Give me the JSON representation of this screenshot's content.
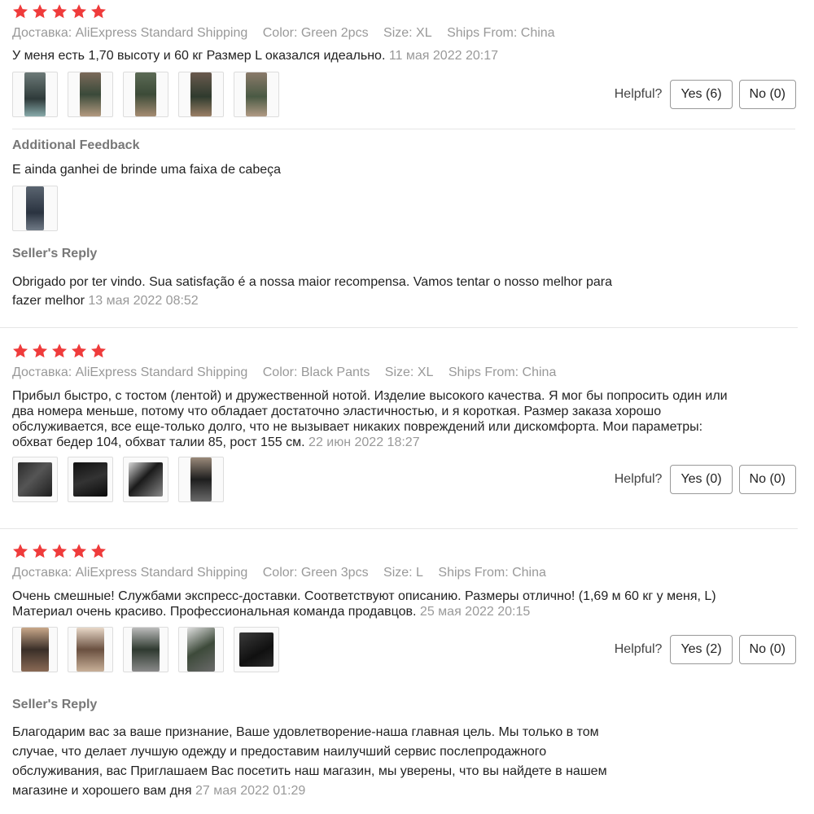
{
  "colors": {
    "star": "#ef3b3b",
    "muted": "#999999"
  },
  "reviews": [
    {
      "stars": 5,
      "shipping": "Доставка: AliExpress Standard Shipping",
      "color": "Color: Green 2pcs",
      "size": "Size: XL",
      "ships_from": "Ships From: China",
      "text": "У меня есть 1,70 высоту и 60 кг Размер L оказался идеально.",
      "date": "11 мая 2022 20:17",
      "helpful_label": "Helpful?",
      "yes_label": "Yes (6)",
      "no_label": "No (0)",
      "additional_feedback_title": "Additional Feedback",
      "additional_feedback_text": "E ainda ganhei de brinde uma faixa de cabeça",
      "seller_reply_title": "Seller's Reply",
      "seller_reply_line1": "Obrigado por ter vindo. Sua satisfação é a nossa maior recompensa. Vamos tentar o nosso melhor para",
      "seller_reply_line2": "fazer melhor",
      "seller_reply_date": "13 мая 2022 08:52"
    },
    {
      "stars": 5,
      "shipping": "Доставка: AliExpress Standard Shipping",
      "color": "Color: Black Pants",
      "size": "Size: XL",
      "ships_from": "Ships From: China",
      "text_line1": "Прибыл быстро, с тостом (лентой) и дружественной нотой. Изделие высокого качества. Я мог бы попросить один или",
      "text_line2": "два номера меньше, потому что обладает достаточно эластичностью, и я короткая. Размер заказа хорошо",
      "text_line3": "обслуживается, все еще-только долго, что не вызывает никаких повреждений или дискомфорта. Мои параметры:",
      "text_line4": "обхват бедер 104, обхват талии 85, рост 155 см.",
      "date": "22 июн 2022 18:27",
      "helpful_label": "Helpful?",
      "yes_label": "Yes (0)",
      "no_label": "No (0)"
    },
    {
      "stars": 5,
      "shipping": "Доставка: AliExpress Standard Shipping",
      "color": "Color: Green 3pcs",
      "size": "Size: L",
      "ships_from": "Ships From: China",
      "text_line1": "Очень смешные! Службами экспресс-доставки. Соответствуют описанию. Размеры отлично! (1,69 м 60 кг у меня, L)",
      "text_line2": "Материал очень красиво. Профессиональная команда продавцов.",
      "date": "25 мая 2022 20:15",
      "helpful_label": "Helpful?",
      "yes_label": "Yes (2)",
      "no_label": "No (0)",
      "seller_reply_title": "Seller's Reply",
      "seller_reply_line1": "Благодарим вас за ваше признание, Ваше удовлетворение-наша главная цель. Мы только в том",
      "seller_reply_line2": "случае, что делает лучшую одежду и предоставим наилучший сервис послепродажного",
      "seller_reply_line3": "обслуживания, вас Приглашаем Вас посетить наш магазин, мы уверены, что вы найдете в нашем",
      "seller_reply_line4": "магазине и хорошего вам дня",
      "seller_reply_date": "27 мая 2022 01:29"
    }
  ]
}
